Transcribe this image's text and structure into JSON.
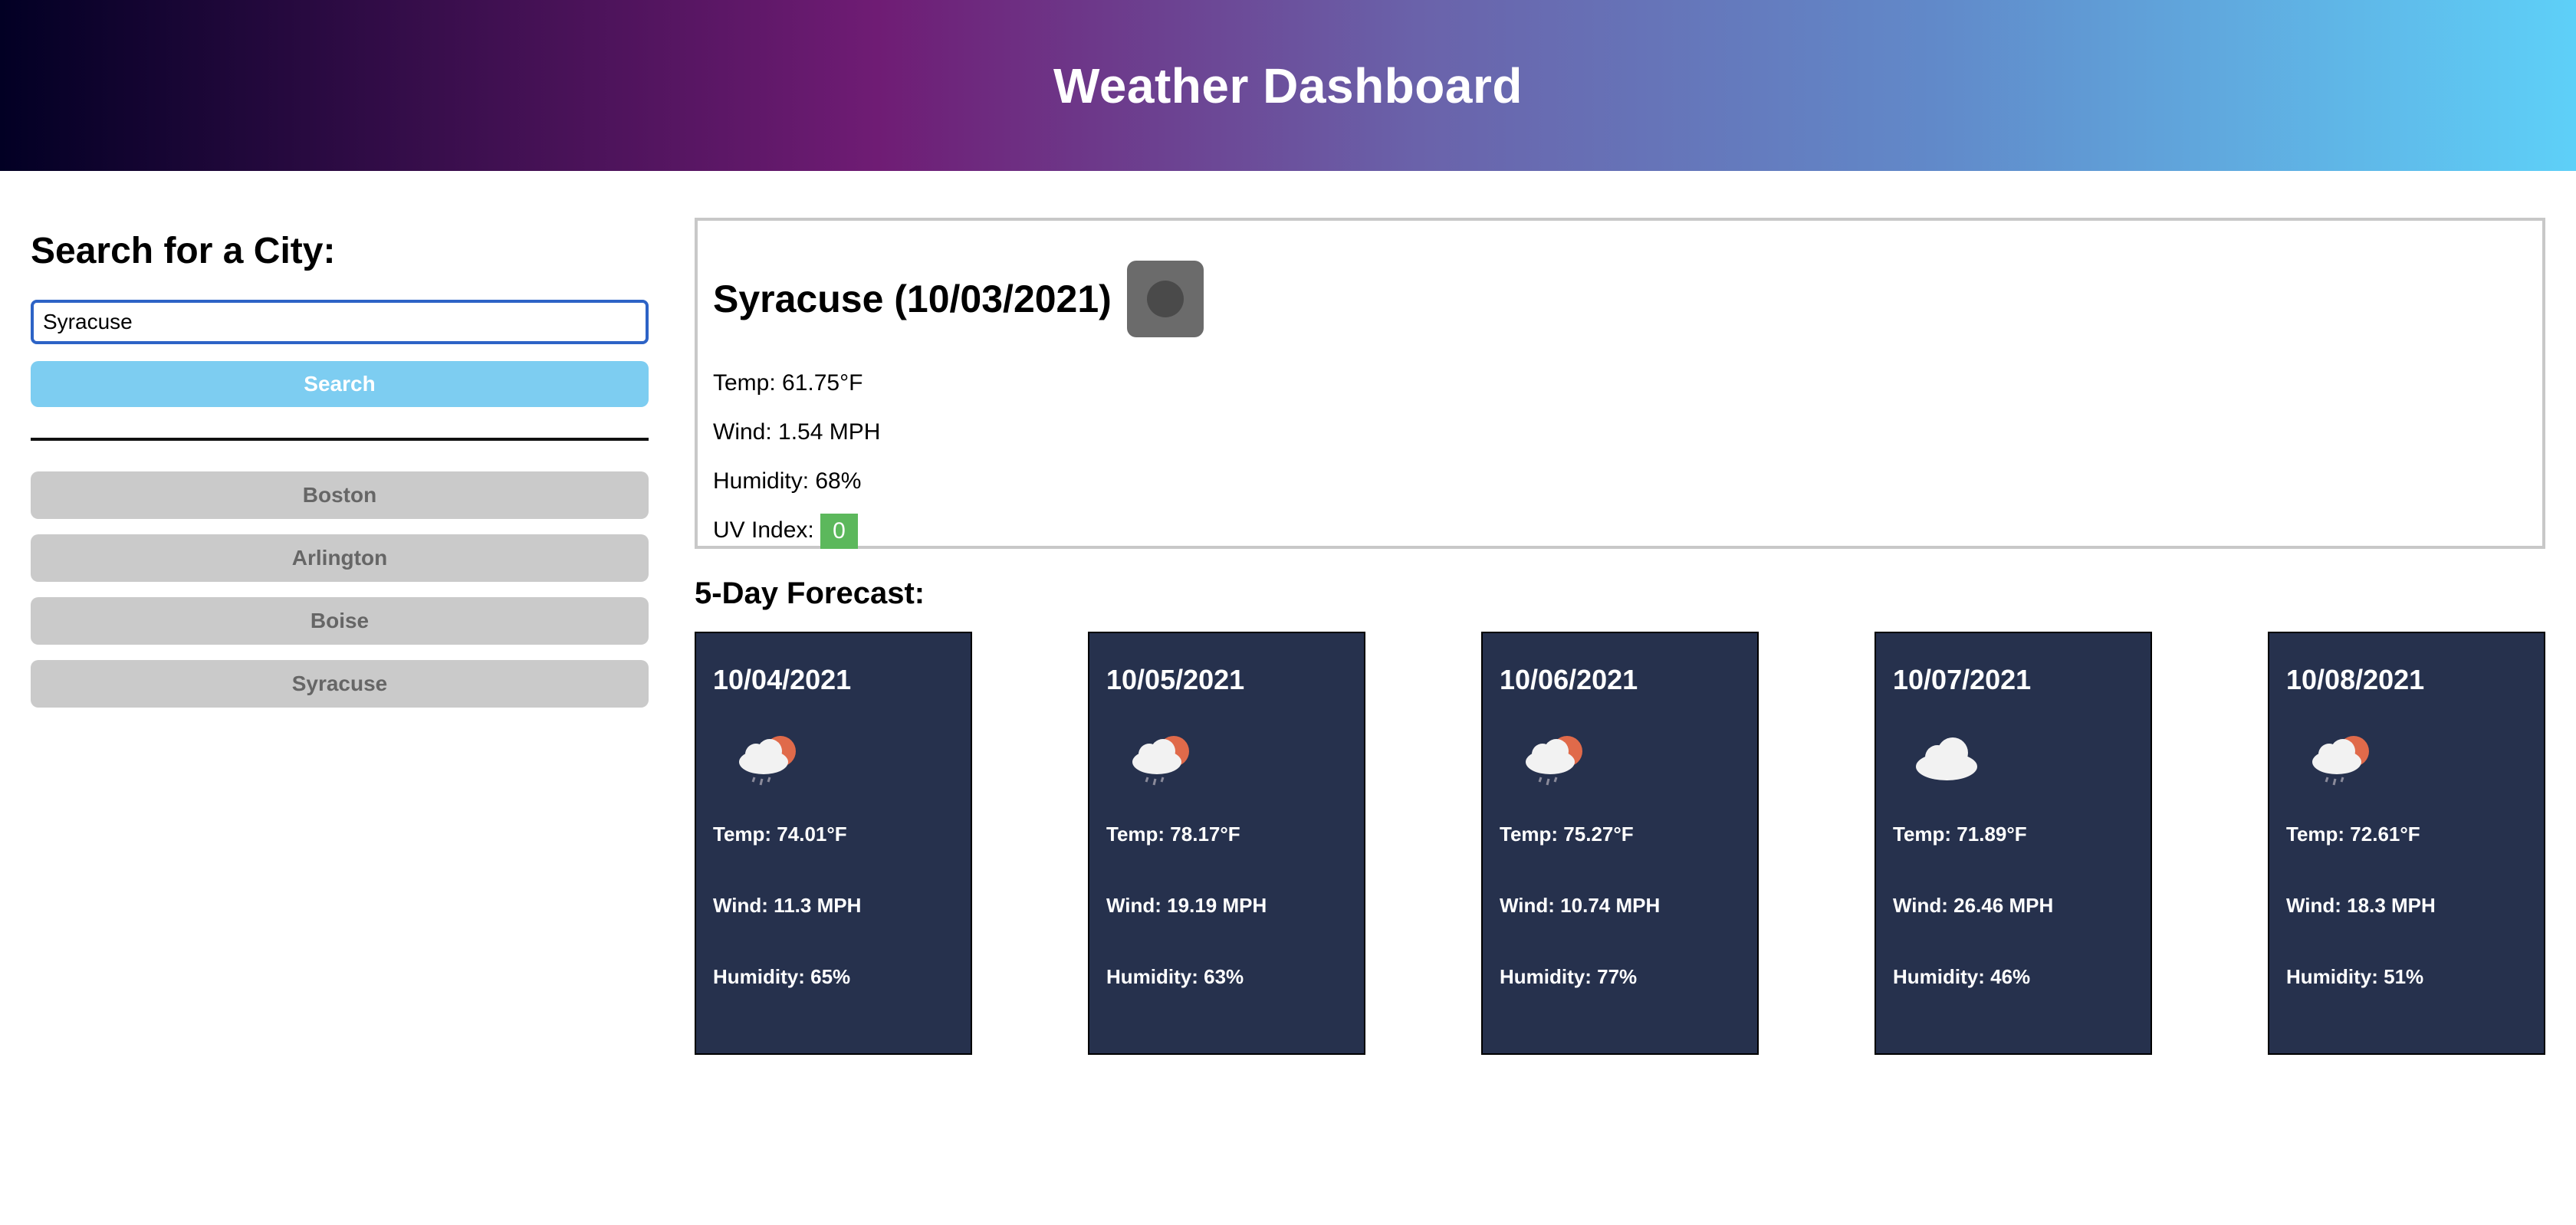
{
  "header": {
    "title": "Weather Dashboard"
  },
  "search": {
    "heading": "Search for a City:",
    "input_value": "Syracuse",
    "button_label": "Search"
  },
  "history": [
    "Boston",
    "Arlington",
    "Boise",
    "Syracuse"
  ],
  "current": {
    "title": "Syracuse (10/03/2021)",
    "temp": "Temp: 61.75°F",
    "wind": "Wind: 1.54 MPH",
    "humidity": "Humidity: 68%",
    "uv_label": "UV Index: ",
    "uv_value": "0",
    "uv_color": "#5cb85c",
    "icon": "weather-placeholder-icon"
  },
  "forecast": {
    "title": "5-Day Forecast:",
    "days": [
      {
        "date": "10/04/2021",
        "icon": "rain-cloud-sun-icon",
        "temp": "Temp: 74.01°F",
        "wind": "Wind: 11.3 MPH",
        "humidity": "Humidity: 65%"
      },
      {
        "date": "10/05/2021",
        "icon": "rain-cloud-sun-icon",
        "temp": "Temp: 78.17°F",
        "wind": "Wind: 19.19 MPH",
        "humidity": "Humidity: 63%"
      },
      {
        "date": "10/06/2021",
        "icon": "rain-cloud-sun-icon",
        "temp": "Temp: 75.27°F",
        "wind": "Wind: 10.74 MPH",
        "humidity": "Humidity: 77%"
      },
      {
        "date": "10/07/2021",
        "icon": "cloud-icon",
        "temp": "Temp: 71.89°F",
        "wind": "Wind: 26.46 MPH",
        "humidity": "Humidity: 46%"
      },
      {
        "date": "10/08/2021",
        "icon": "rain-cloud-sun-icon",
        "temp": "Temp: 72.61°F",
        "wind": "Wind: 18.3 MPH",
        "humidity": "Humidity: 51%"
      }
    ]
  }
}
